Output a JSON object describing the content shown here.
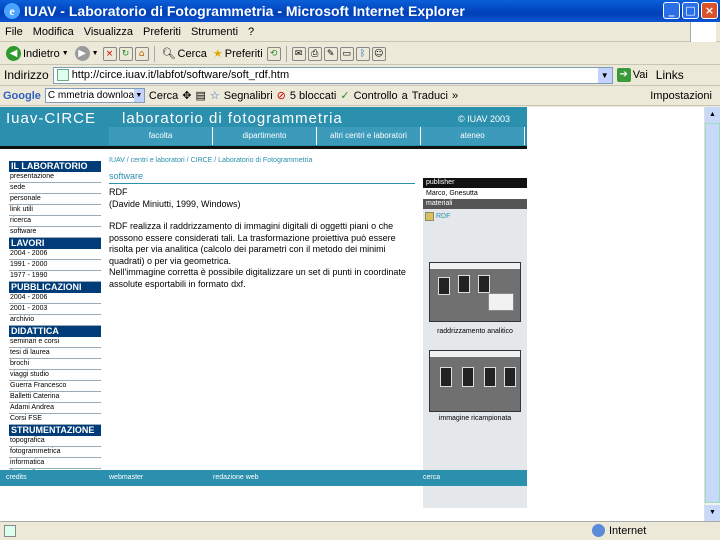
{
  "window": {
    "title": "IUAV - Laboratorio di Fotogrammetria - Microsoft Internet Explorer"
  },
  "menu": [
    "File",
    "Modifica",
    "Visualizza",
    "Preferiti",
    "Strumenti",
    "?"
  ],
  "toolbar": {
    "back": "Indietro",
    "search": "Cerca",
    "favorites": "Preferiti"
  },
  "address": {
    "label": "Indirizzo",
    "url": "http://circe.iuav.it/labfot/software/soft_rdf.htm",
    "go": "Vai",
    "links": "Links"
  },
  "google": {
    "logo": "Google",
    "query": "C mmetria download",
    "search": "Cerca",
    "bookmarks": "Segnalibri",
    "blocked": "5 bloccati",
    "check": "Controllo",
    "translate": "Traduci",
    "settings": "Impostazioni"
  },
  "site": {
    "title_left": "Iuav-CIRCE",
    "title_right": "laboratorio di fotogrammetria",
    "copyright": "© IUAV 2003",
    "tabs": [
      "facolta",
      "dipartimento",
      "altri centri e laboratori",
      "ateneo"
    ],
    "breadcrumb": "IUAV / centri e laboratori / CIRCE / Laboratorio di Fotogrammetria",
    "section_heading": "software",
    "sidebar": [
      {
        "title": "IL LABORATORIO",
        "items": [
          "presentazione",
          "sede",
          "personale",
          "link utili",
          "ricerca",
          "software"
        ]
      },
      {
        "title": "LAVORI",
        "items": [
          "2004 - 2006",
          "1991 - 2000",
          "1977 - 1990"
        ]
      },
      {
        "title": "PUBBLICAZIONI",
        "items": [
          "2004 - 2006",
          "2001 - 2003",
          "archivio"
        ]
      },
      {
        "title": "DIDATTICA",
        "items": [
          "seminari e corsi",
          "tesi di laurea",
          "brochi",
          "viaggi studio",
          "Guerra Francesco",
          "Balletti Caterina",
          "Adami Andrea",
          "Corsi FSE"
        ]
      },
      {
        "title": "STRUMENTAZIONE",
        "items": [
          "topografica",
          "fotogrammetrica",
          "informatica",
          "fotografica"
        ]
      }
    ],
    "main": {
      "name": "RDF",
      "author": "(Davide Miniutti, 1999, Windows)",
      "para1": "RDF realizza il raddrizzamento di immagini digitali di oggetti piani o che possono essere considerati tali. La trasformazione proiettiva può essere risolta per via analitica (calcolo dei parametri con il metodo dei minimi quadrati) o per via geometrica.",
      "para2": "Nell'immagine corretta è possibile digitalizzare un set di punti in coordinate assolute esportabili in formato dxf."
    },
    "right_panel": {
      "publisher_label": "publisher",
      "publisher": "Marco, Gnesutta",
      "materials_label": "materiali",
      "file": "RDF",
      "caption1": "raddrizzamento analitico",
      "caption2": "immagine ricampionata"
    },
    "footer": [
      "credits",
      "webmaster",
      "redazione web",
      "cerca"
    ]
  },
  "status": {
    "zone": "Internet"
  },
  "colors": {
    "site_accent": "#2b8fae",
    "sidebar_section": "#003c78",
    "titlebar": "#0a5fd8"
  }
}
